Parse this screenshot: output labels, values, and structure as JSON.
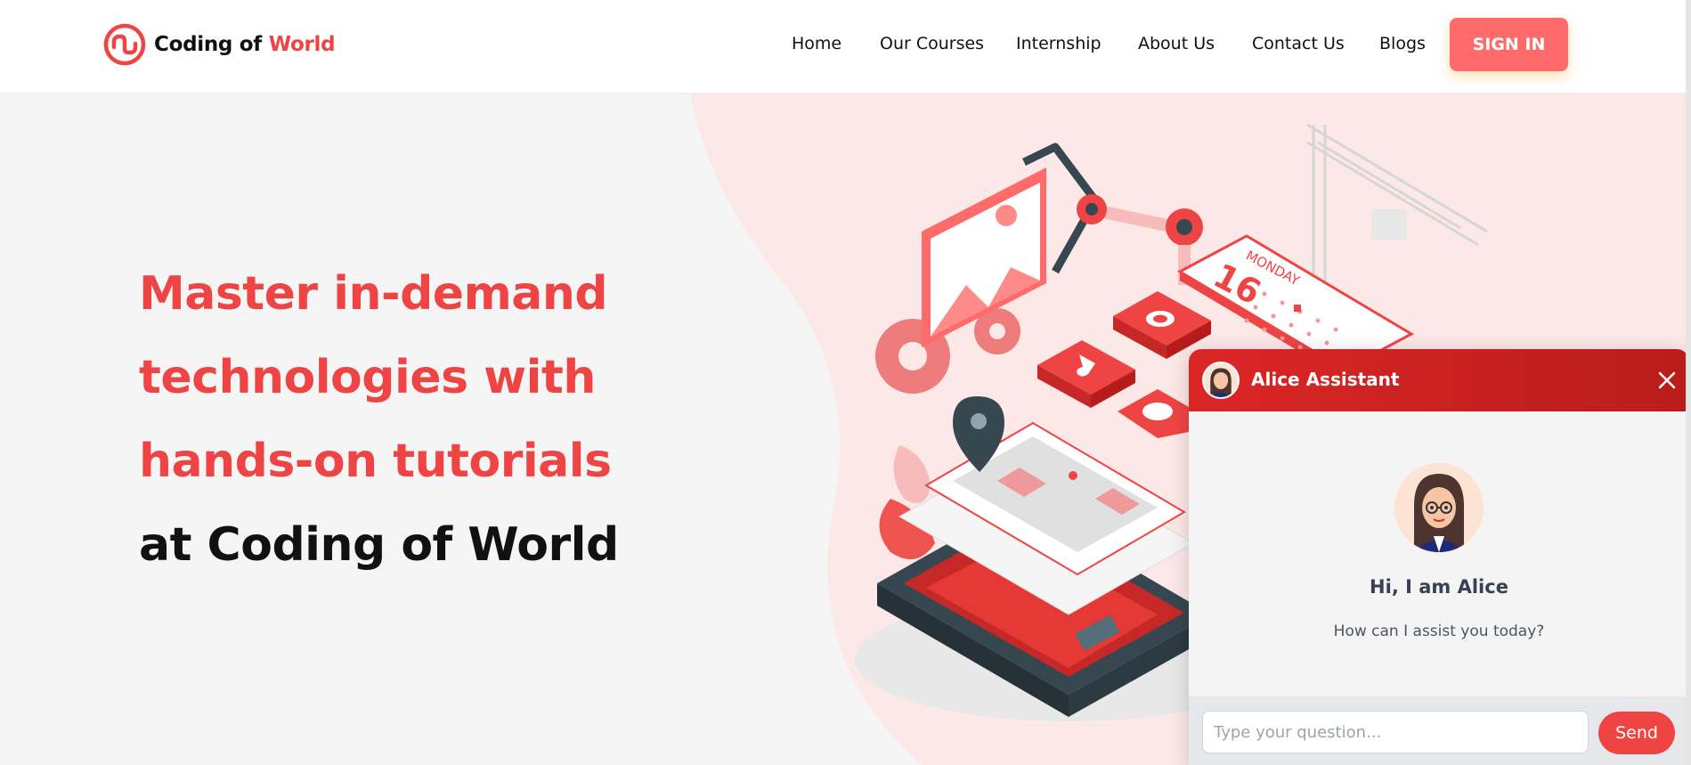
{
  "brand": {
    "name_prefix": "Coding of ",
    "name_accent": "World",
    "accent_color": "#ef4444",
    "logo_icon": "logo-icon"
  },
  "nav": {
    "items": [
      {
        "label": "Home"
      },
      {
        "label": "Our Courses"
      },
      {
        "label": "Internship"
      },
      {
        "label": "About Us"
      },
      {
        "label": "Contact Us"
      },
      {
        "label": "Blogs"
      }
    ],
    "signin_label": "SIGN IN",
    "signin_color": "#ff6b6b"
  },
  "hero": {
    "lines": [
      "Master in-demand",
      "technologies with",
      "hands-on tutorials",
      "at Coding of World"
    ],
    "illustration_icon": "isometric-app-illustration-icon"
  },
  "calendar": {
    "day_name": "MONDAY",
    "day_number": "16"
  },
  "chat": {
    "title": "Alice Assistant",
    "greeting": "Hi, I am Alice",
    "subtitle": "How can I assist you today?",
    "input_placeholder": "Type your question...",
    "send_label": "Send",
    "header_color": "#dc2626",
    "close_icon": "close-icon",
    "avatar_icon": "avatar-icon"
  }
}
